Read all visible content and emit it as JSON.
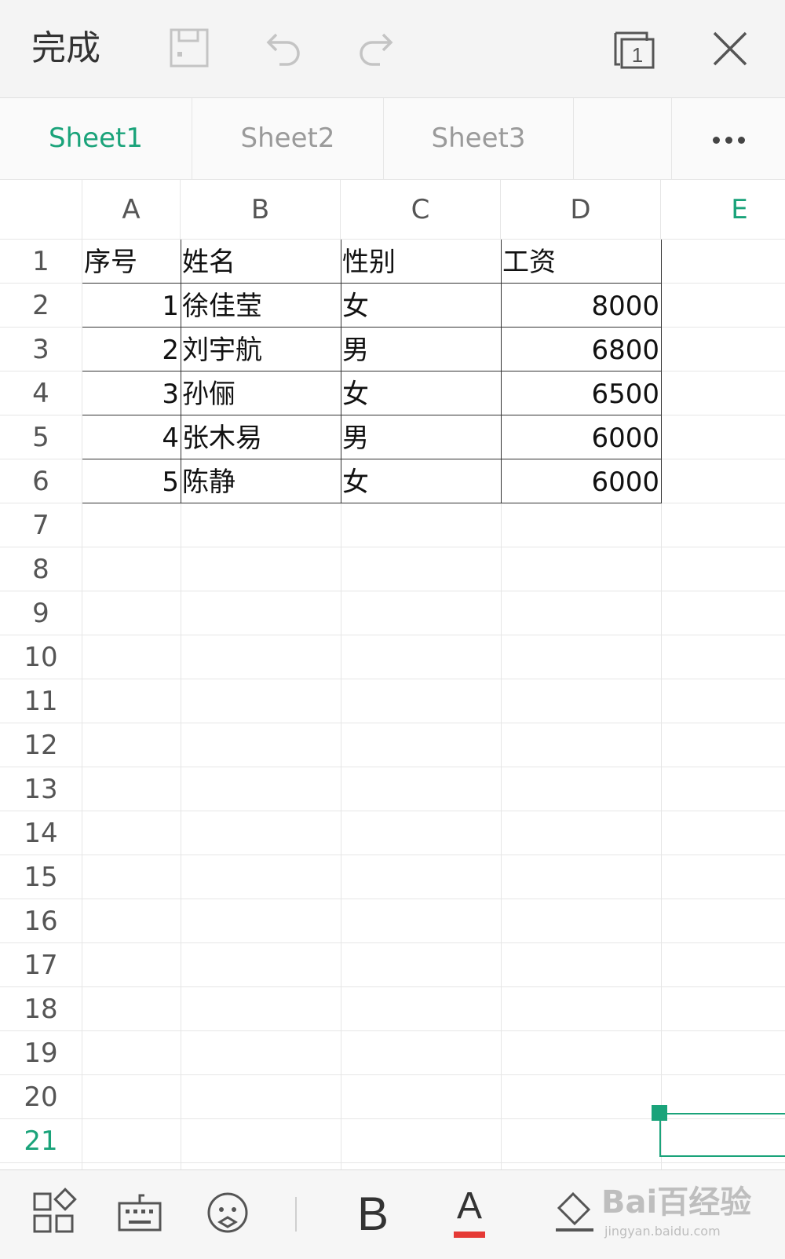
{
  "toolbar": {
    "done_label": "完成",
    "icons": [
      "save-icon",
      "undo-icon",
      "redo-icon",
      "window-switch-icon",
      "close-icon"
    ],
    "window_count": "1"
  },
  "tabs": {
    "items": [
      {
        "label": "Sheet1",
        "active": true
      },
      {
        "label": "Sheet2",
        "active": false
      },
      {
        "label": "Sheet3",
        "active": false
      }
    ],
    "more_icon": "more-horizontal-icon"
  },
  "grid": {
    "columns": [
      "A",
      "B",
      "C",
      "D",
      "E"
    ],
    "selected_column": "E",
    "rows": [
      "1",
      "2",
      "3",
      "4",
      "5",
      "6",
      "7",
      "8",
      "9",
      "10",
      "11",
      "12",
      "13",
      "14",
      "15",
      "16",
      "17",
      "18",
      "19",
      "20",
      "21"
    ],
    "selected_row": "21",
    "table": {
      "header": [
        "序号",
        "姓名",
        "性别",
        "工资"
      ],
      "records": [
        {
          "no": "1",
          "name": "徐佳莹",
          "gender": "女",
          "salary": "8000"
        },
        {
          "no": "2",
          "name": "刘宇航",
          "gender": "男",
          "salary": "6800"
        },
        {
          "no": "3",
          "name": "孙俪",
          "gender": "女",
          "salary": "6500"
        },
        {
          "no": "4",
          "name": "张木易",
          "gender": "男",
          "salary": "6000"
        },
        {
          "no": "5",
          "name": "陈静",
          "gender": "女",
          "salary": "6000"
        }
      ]
    },
    "selected_cell": "E21"
  },
  "bottombar": {
    "icons": [
      "tools-grid-icon",
      "keyboard-icon",
      "emoji-icon",
      "bold-icon",
      "font-color-icon",
      "fill-color-icon"
    ],
    "bold_label": "B",
    "font_color_label": "A",
    "font_color": "#e53935"
  },
  "watermark": {
    "brand": "Bai百经验",
    "url": "jingyan.baidu.com"
  },
  "colors": {
    "accent": "#1aa37a",
    "toolbar_bg": "#f4f4f4",
    "grid_line": "#e6e6e6"
  }
}
